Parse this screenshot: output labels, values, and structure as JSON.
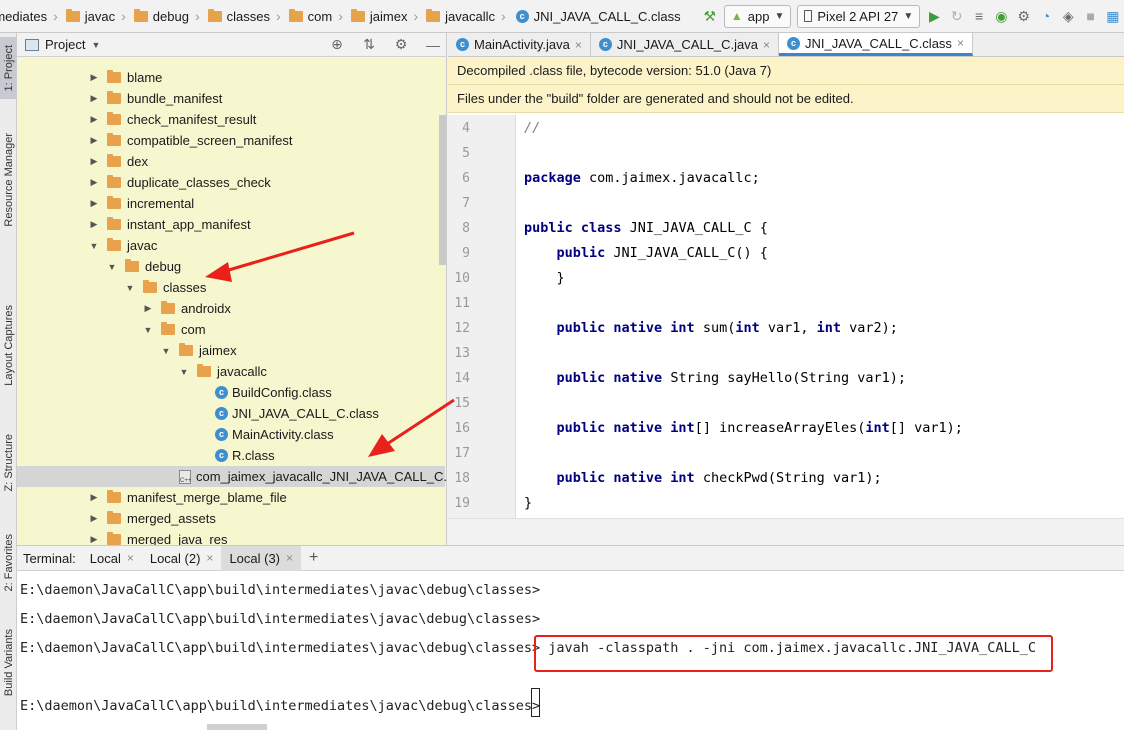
{
  "breadcrumb": [
    {
      "label": "rmediates",
      "kind": "folder"
    },
    {
      "label": "javac",
      "kind": "folder"
    },
    {
      "label": "debug",
      "kind": "folder"
    },
    {
      "label": "classes",
      "kind": "folder"
    },
    {
      "label": "com",
      "kind": "folder"
    },
    {
      "label": "jaimex",
      "kind": "folder"
    },
    {
      "label": "javacallc",
      "kind": "folder"
    },
    {
      "label": "JNI_JAVA_CALL_C.class",
      "kind": "class"
    }
  ],
  "toolbar": {
    "run_config": "app",
    "device": "Pixel 2 API 27"
  },
  "left_strip": {
    "project": "1: Project",
    "resource_manager": "Resource Manager",
    "layout_captures": "Layout Captures",
    "structure": "Z: Structure",
    "favorites": "2: Favorites",
    "build_variants": "Build Variants"
  },
  "project_panel": {
    "title": "Project",
    "tree": [
      {
        "label": "blame",
        "type": "folder",
        "expanded": false
      },
      {
        "label": "bundle_manifest",
        "type": "folder",
        "expanded": false
      },
      {
        "label": "check_manifest_result",
        "type": "folder",
        "expanded": false
      },
      {
        "label": "compatible_screen_manifest",
        "type": "folder",
        "expanded": false
      },
      {
        "label": "dex",
        "type": "folder",
        "expanded": false
      },
      {
        "label": "duplicate_classes_check",
        "type": "folder",
        "expanded": false
      },
      {
        "label": "incremental",
        "type": "folder",
        "expanded": false
      },
      {
        "label": "instant_app_manifest",
        "type": "folder",
        "expanded": false
      },
      {
        "label": "javac",
        "type": "folder",
        "expanded": true
      },
      {
        "label": "debug",
        "type": "folder",
        "expanded": true
      },
      {
        "label": "classes",
        "type": "folder",
        "expanded": true
      },
      {
        "label": "androidx",
        "type": "folder",
        "expanded": false
      },
      {
        "label": "com",
        "type": "folder",
        "expanded": true
      },
      {
        "label": "jaimex",
        "type": "folder",
        "expanded": true
      },
      {
        "label": "javacallc",
        "type": "folder",
        "expanded": true
      },
      {
        "label": "BuildConfig.class",
        "type": "class"
      },
      {
        "label": "JNI_JAVA_CALL_C.class",
        "type": "class"
      },
      {
        "label": "MainActivity.class",
        "type": "class"
      },
      {
        "label": "R.class",
        "type": "class"
      },
      {
        "label": "com_jaimex_javacallc_JNI_JAVA_CALL_C.h",
        "type": "header",
        "selected": true
      },
      {
        "label": "manifest_merge_blame_file",
        "type": "folder",
        "expanded": false
      },
      {
        "label": "merged_assets",
        "type": "folder",
        "expanded": false
      },
      {
        "label": "merged_java_res",
        "type": "folder",
        "expanded": false
      }
    ]
  },
  "editor": {
    "tabs": [
      {
        "label": "MainActivity.java",
        "active": false
      },
      {
        "label": "JNI_JAVA_CALL_C.java",
        "active": false
      },
      {
        "label": "JNI_JAVA_CALL_C.class",
        "active": true
      }
    ],
    "banner_decompiled": "Decompiled .class file, bytecode version: 51.0 (Java 7)",
    "banner_build": "Files under the \"build\" folder are generated and should not be edited.",
    "lines": [
      {
        "n": "4",
        "segments": [
          {
            "t": "//",
            "c": "cm"
          }
        ]
      },
      {
        "n": "5",
        "segments": []
      },
      {
        "n": "6",
        "segments": [
          {
            "t": "package",
            "c": "kw"
          },
          {
            "t": " com.jaimex.javacallc;",
            "c": ""
          }
        ]
      },
      {
        "n": "7",
        "segments": []
      },
      {
        "n": "8",
        "segments": [
          {
            "t": "public class",
            "c": "kw"
          },
          {
            "t": " JNI_JAVA_CALL_C {",
            "c": ""
          }
        ]
      },
      {
        "n": "9",
        "segments": [
          {
            "t": "    ",
            "c": ""
          },
          {
            "t": "public",
            "c": "kw"
          },
          {
            "t": " JNI_JAVA_CALL_C() {",
            "c": ""
          }
        ]
      },
      {
        "n": "10",
        "segments": [
          {
            "t": "    }",
            "c": ""
          }
        ]
      },
      {
        "n": "11",
        "segments": []
      },
      {
        "n": "12",
        "segments": [
          {
            "t": "    ",
            "c": ""
          },
          {
            "t": "public native int",
            "c": "kw"
          },
          {
            "t": " sum(",
            "c": ""
          },
          {
            "t": "int",
            "c": "kw"
          },
          {
            "t": " var1, ",
            "c": ""
          },
          {
            "t": "int",
            "c": "kw"
          },
          {
            "t": " var2);",
            "c": ""
          }
        ]
      },
      {
        "n": "13",
        "segments": []
      },
      {
        "n": "14",
        "segments": [
          {
            "t": "    ",
            "c": ""
          },
          {
            "t": "public native",
            "c": "kw"
          },
          {
            "t": " String sayHello(String var1);",
            "c": ""
          }
        ]
      },
      {
        "n": "15",
        "segments": []
      },
      {
        "n": "16",
        "segments": [
          {
            "t": "    ",
            "c": ""
          },
          {
            "t": "public native int",
            "c": "kw"
          },
          {
            "t": "[] increaseArrayEles(",
            "c": ""
          },
          {
            "t": "int",
            "c": "kw"
          },
          {
            "t": "[] var1);",
            "c": ""
          }
        ]
      },
      {
        "n": "17",
        "segments": []
      },
      {
        "n": "18",
        "segments": [
          {
            "t": "    ",
            "c": ""
          },
          {
            "t": "public native int",
            "c": "kw"
          },
          {
            "t": " checkPwd(String var1);",
            "c": ""
          }
        ]
      },
      {
        "n": "19",
        "segments": [
          {
            "t": "}",
            "c": ""
          }
        ]
      }
    ]
  },
  "terminal": {
    "label": "Terminal:",
    "tabs": [
      {
        "label": "Local",
        "active": false
      },
      {
        "label": "Local (2)",
        "active": false
      },
      {
        "label": "Local (3)",
        "active": true
      }
    ],
    "add_label": "+",
    "lines": [
      "E:\\daemon\\JavaCallC\\app\\build\\intermediates\\javac\\debug\\classes>",
      "E:\\daemon\\JavaCallC\\app\\build\\intermediates\\javac\\debug\\classes>",
      "E:\\daemon\\JavaCallC\\app\\build\\intermediates\\javac\\debug\\classes> javah -classpath . -jni com.jaimex.javacallc.JNI_JAVA_CALL_C",
      "",
      "E:\\daemon\\JavaCallC\\app\\build\\intermediates\\javac\\debug\\classes>"
    ]
  },
  "colors": {
    "annotation": "#e8211b",
    "folder": "#e8a24b",
    "class_icon": "#3d8fcf",
    "keyword": "#000080"
  }
}
